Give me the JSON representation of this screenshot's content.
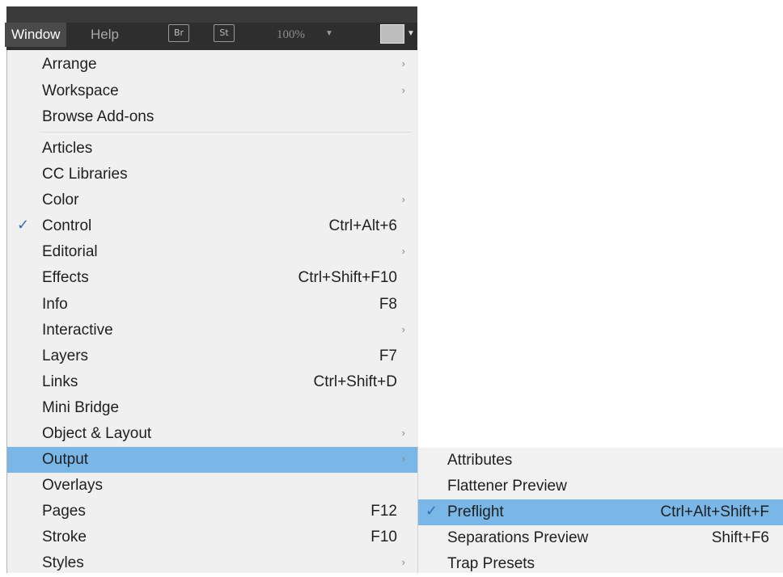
{
  "menubar": {
    "window_label": "Window",
    "help_label": "Help",
    "br_badge": "Br",
    "st_badge": "St",
    "zoom": "100%",
    "zoom_caret": "▼",
    "view_caret": "▼"
  },
  "window_menu": {
    "items": [
      {
        "label": "Arrange",
        "shortcut": "",
        "arrow": "›",
        "check": ""
      },
      {
        "label": "Workspace",
        "shortcut": "",
        "arrow": "›",
        "check": ""
      },
      {
        "label": "Browse Add-ons",
        "shortcut": "",
        "arrow": "",
        "check": ""
      },
      {
        "label": "Articles",
        "shortcut": "",
        "arrow": "",
        "check": ""
      },
      {
        "label": "CC Libraries",
        "shortcut": "",
        "arrow": "",
        "check": ""
      },
      {
        "label": "Color",
        "shortcut": "",
        "arrow": "›",
        "check": ""
      },
      {
        "label": "Control",
        "shortcut": "Ctrl+Alt+6",
        "arrow": "",
        "check": "✓"
      },
      {
        "label": "Editorial",
        "shortcut": "",
        "arrow": "›",
        "check": ""
      },
      {
        "label": "Effects",
        "shortcut": "Ctrl+Shift+F10",
        "arrow": "",
        "check": ""
      },
      {
        "label": "Info",
        "shortcut": "F8",
        "arrow": "",
        "check": ""
      },
      {
        "label": "Interactive",
        "shortcut": "",
        "arrow": "›",
        "check": ""
      },
      {
        "label": "Layers",
        "shortcut": "F7",
        "arrow": "",
        "check": ""
      },
      {
        "label": "Links",
        "shortcut": "Ctrl+Shift+D",
        "arrow": "",
        "check": ""
      },
      {
        "label": "Mini Bridge",
        "shortcut": "",
        "arrow": "",
        "check": ""
      },
      {
        "label": "Object & Layout",
        "shortcut": "",
        "arrow": "›",
        "check": ""
      },
      {
        "label": "Output",
        "shortcut": "",
        "arrow": "›",
        "check": ""
      },
      {
        "label": "Overlays",
        "shortcut": "",
        "arrow": "",
        "check": ""
      },
      {
        "label": "Pages",
        "shortcut": "F12",
        "arrow": "",
        "check": ""
      },
      {
        "label": "Stroke",
        "shortcut": "F10",
        "arrow": "",
        "check": ""
      },
      {
        "label": "Styles",
        "shortcut": "",
        "arrow": "›",
        "check": ""
      }
    ]
  },
  "output_submenu": {
    "items": [
      {
        "label": "Attributes",
        "shortcut": "",
        "check": ""
      },
      {
        "label": "Flattener Preview",
        "shortcut": "",
        "check": ""
      },
      {
        "label": "Preflight",
        "shortcut": "Ctrl+Alt+Shift+F",
        "check": "✓"
      },
      {
        "label": "Separations Preview",
        "shortcut": "Shift+F6",
        "check": ""
      },
      {
        "label": "Trap Presets",
        "shortcut": "",
        "check": ""
      }
    ]
  },
  "colors": {
    "highlight": "#78b7e6",
    "menubar": "#2e2e2e",
    "menu_bg": "#f0f0f0",
    "check": "#2f6fb3"
  }
}
